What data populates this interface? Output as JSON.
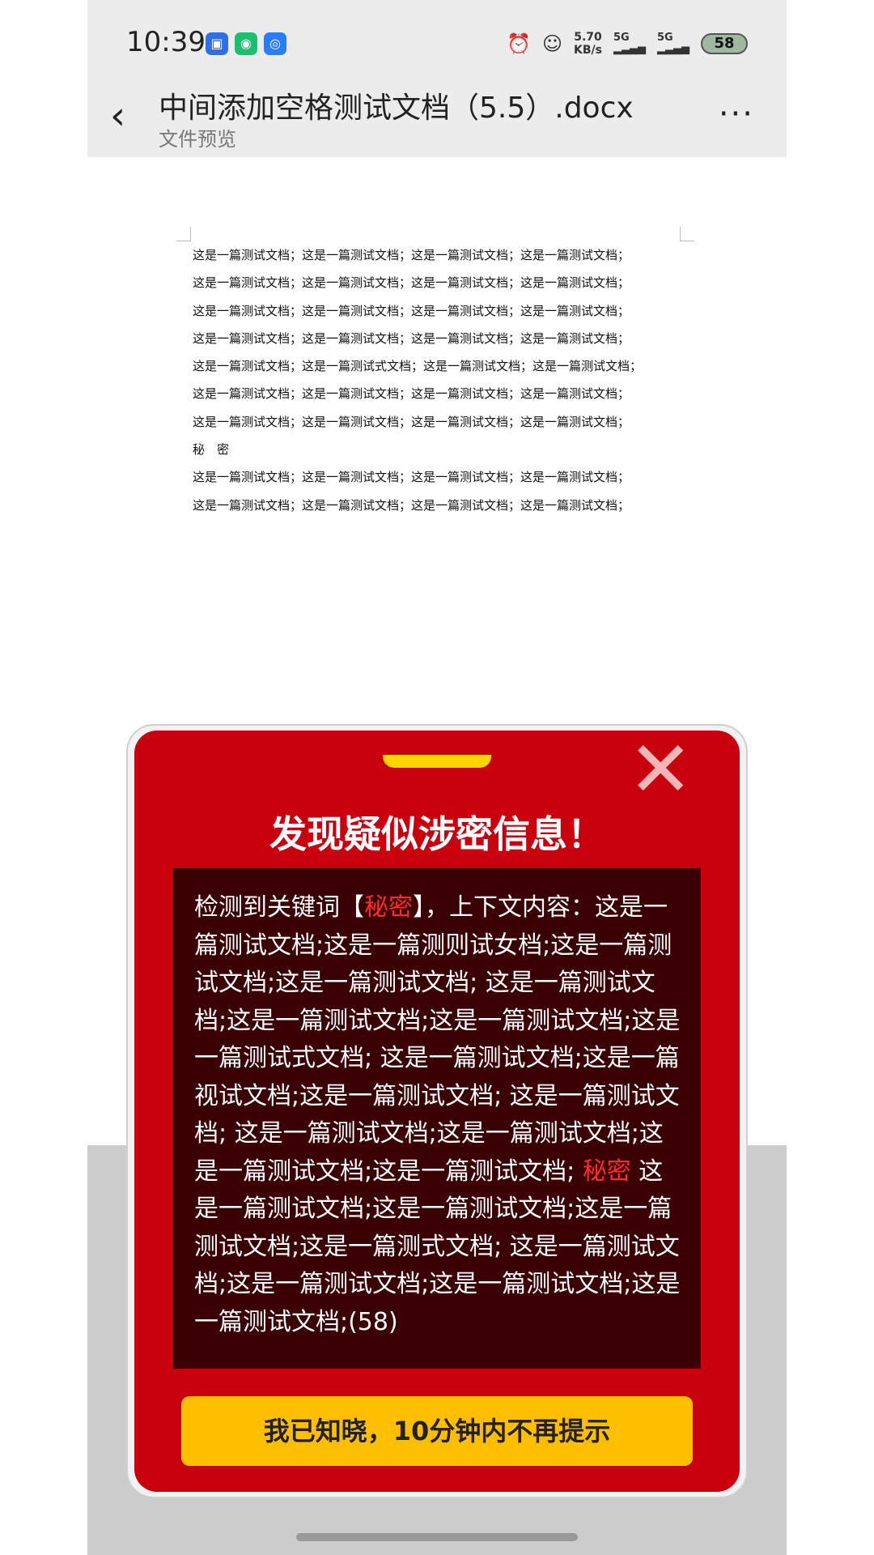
{
  "status": {
    "time": "10:39",
    "speed_value": "5.70",
    "speed_unit": "KB/s",
    "signal1": "5G",
    "signal2": "5G",
    "battery": "58"
  },
  "header": {
    "title": "中间添加空格测试文档（5.5）.docx",
    "subtitle": "文件预览",
    "back_icon": "‹",
    "more_icon": "···"
  },
  "document": {
    "lines": [
      "这是一篇测试文档；这是一篇测试文档；这是一篇测试文档；这是一篇测试文档；",
      "这是一篇测试文档；这是一篇测试文档；这是一篇测试文档；这是一篇测试文档；",
      "这是一篇测试文档；这是一篇测试文档；这是一篇测试文档；这是一篇测试文档；",
      "这是一篇测试文档；这是一篇测试文档；这是一篇测试文档；这是一篇测试文档；",
      "这是一篇测试文档；这是一篇测试式文档；这是一篇测试文档；这是一篇测试文档；",
      "这是一篇测试文档；这是一篇测试文档；这是一篇测试文档；这是一篇测试文档；",
      "这是一篇测试文档；这是一篇测试文档；这是一篇测试文档；这是一篇测试文档；",
      "秘　密",
      "这是一篇测试文档；这是一篇测试文档；这是一篇测试文档；这是一篇测试文档；",
      "这是一篇测试文档；这是一篇测试文档；这是一篇测试文档；这是一篇测试文档；"
    ]
  },
  "modal": {
    "title": "发现疑似涉密信息！",
    "close_icon": "✕",
    "msg_prefix": "检测到关键词【",
    "keyword": "秘密",
    "msg_mid": "】，上下文内容：这是一篇测试文档;这是一篇测则试女档;这是一篇测试文档;这是一篇测试文档; 这是一篇测试文档;这是一篇测试文档;这是一篇测试文档;这是一篇测试式文档; 这是一篇测试文档;这是一篇视试文档;这是一篇测试文档; 这是一篇测试文档; 这是一篇测试文档;这是一篇测试文档;这是一篇测试文档;这是一篇测试文档; ",
    "keyword2": "秘密",
    "msg_suffix": " 这是一篇测试文档;这是一篇测试文档;这是一篇测试文档;这是一篇测式文档; 这是一篇测试文档;这是一篇测试文档;这是一篇测试文档;这是一篇测试文档;(58)",
    "ack_label": "我已知晓，10分钟内不再提示"
  },
  "colors": {
    "modal_red": "#c9000e",
    "msg_bg": "#3a0004",
    "keyword": "#ff2a2a",
    "ack_button": "#ffbe00",
    "handle": "#ffd400"
  }
}
